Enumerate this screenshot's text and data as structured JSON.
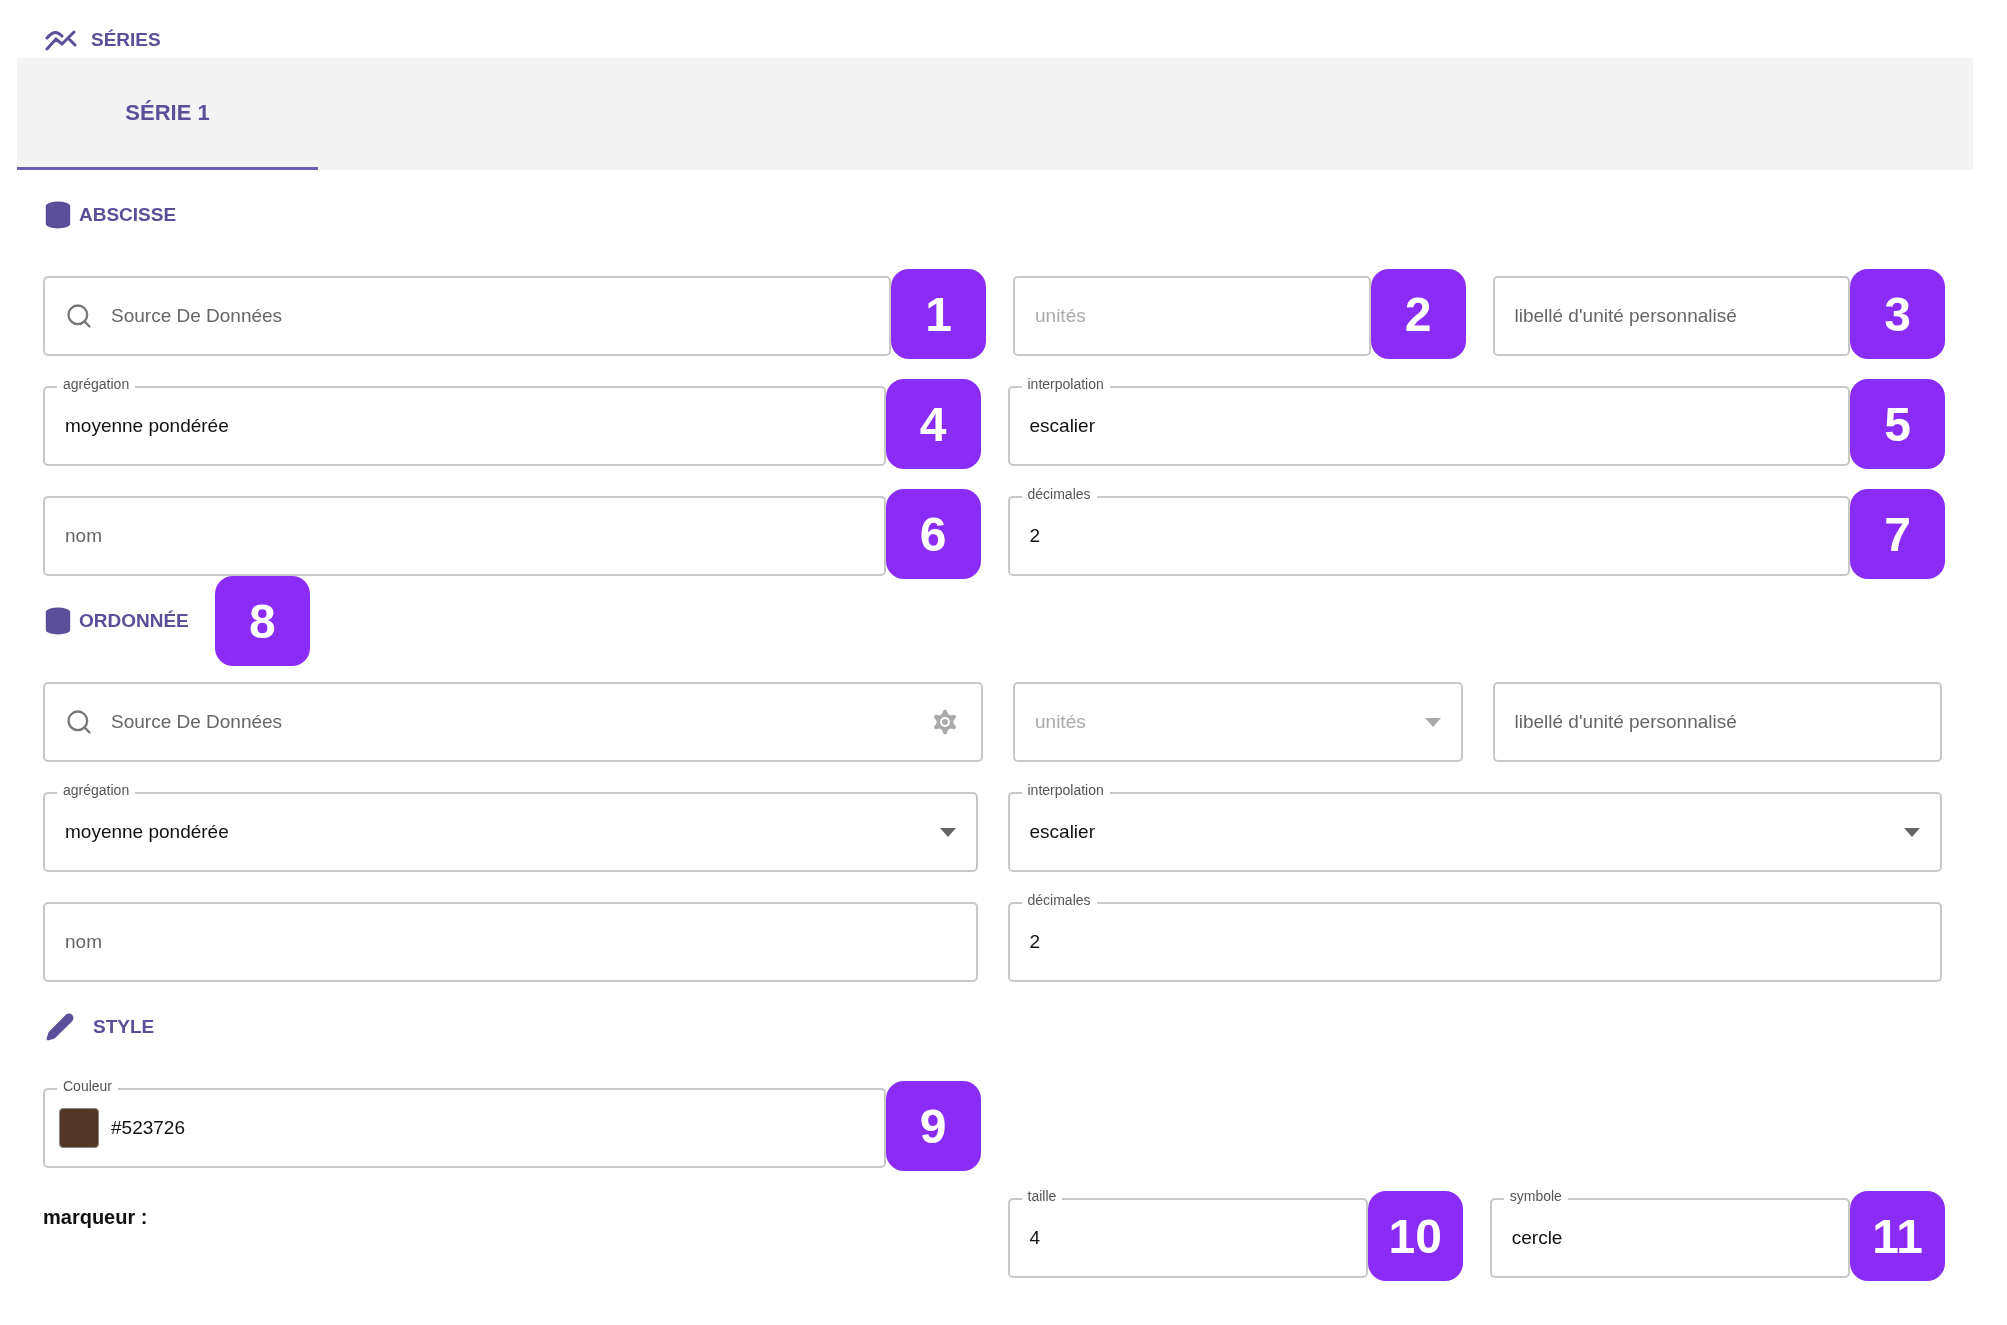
{
  "header": {
    "title": "SÉRIES"
  },
  "tabs": [
    {
      "label": "SÉRIE 1",
      "selected": true
    }
  ],
  "sections": [
    {
      "title": "ABSCISSE",
      "rows": [
        {
          "fields": [
            {
              "kind": "search",
              "placeholder": "Source De Données",
              "badge": "1"
            },
            {
              "kind": "select",
              "placeholder": "unités",
              "disabled": true,
              "badge": "2"
            },
            {
              "kind": "text",
              "placeholder": "libellé d'unité personnalisé",
              "badge": "3"
            }
          ]
        },
        {
          "fields": [
            {
              "kind": "select",
              "label": "agrégation",
              "value": "moyenne pondérée",
              "badge": "4"
            },
            {
              "kind": "select",
              "label": "interpolation",
              "value": "escalier",
              "badge": "5"
            }
          ]
        },
        {
          "fields": [
            {
              "kind": "text",
              "placeholder": "nom",
              "badge": "6"
            },
            {
              "kind": "text",
              "label": "décimales",
              "value": "2",
              "badge": "7"
            }
          ]
        }
      ]
    },
    {
      "title": "ORDONNÉE",
      "badge": "8",
      "rows": [
        {
          "fields": [
            {
              "kind": "search",
              "placeholder": "Source De Données"
            },
            {
              "kind": "select",
              "placeholder": "unités",
              "disabled": true
            },
            {
              "kind": "text",
              "placeholder": "libellé d'unité personnalisé"
            }
          ]
        },
        {
          "fields": [
            {
              "kind": "select",
              "label": "agrégation",
              "value": "moyenne pondérée"
            },
            {
              "kind": "select",
              "label": "interpolation",
              "value": "escalier"
            }
          ]
        },
        {
          "fields": [
            {
              "kind": "text",
              "placeholder": "nom"
            },
            {
              "kind": "text",
              "label": "décimales",
              "value": "2"
            }
          ]
        }
      ]
    },
    {
      "title": "STYLE",
      "rows": [
        {
          "fields": [
            {
              "kind": "color",
              "label": "Couleur",
              "value": "#523726",
              "color": "#523726",
              "badge": "9"
            }
          ]
        },
        {
          "label": "marqueur :",
          "fields": [
            {
              "kind": "text",
              "label": "taille",
              "value": "4",
              "badge": "10"
            },
            {
              "kind": "text",
              "label": "symbole",
              "value": "cercle",
              "badge": "11"
            }
          ]
        }
      ]
    }
  ]
}
